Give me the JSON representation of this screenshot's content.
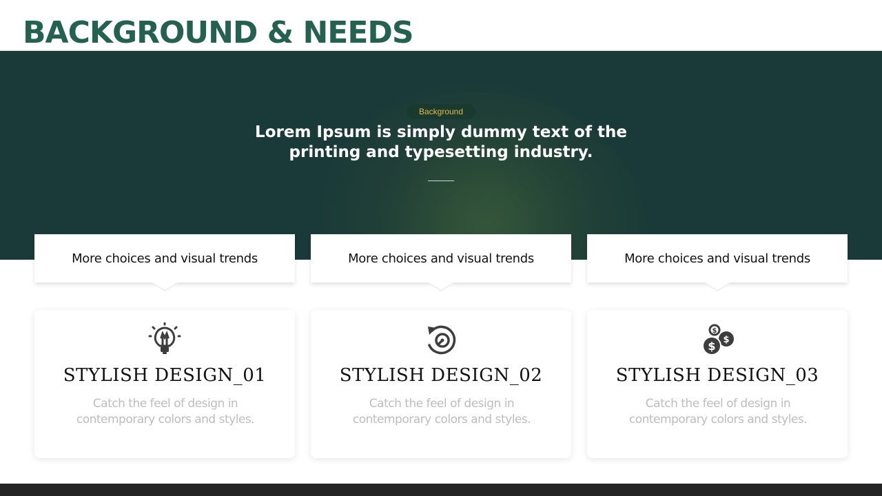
{
  "page": {
    "title": "BACKGROUND & NEEDS"
  },
  "hero": {
    "badge": "Background",
    "text": "Lorem Ipsum is simply dummy text of the printing and typesetting industry."
  },
  "labels": [
    "More choices and visual trends",
    "More choices and visual trends",
    "More choices and visual trends"
  ],
  "cards": [
    {
      "icon": "lightbulb-icon",
      "title": "STYLISH DESIGN_01",
      "desc": "Catch the feel of design in contemporary colors and styles."
    },
    {
      "icon": "clock-rotate-icon",
      "title": "STYLISH DESIGN_02",
      "desc": "Catch the feel of design in contemporary colors and styles."
    },
    {
      "icon": "coins-icon",
      "title": "STYLISH DESIGN_03",
      "desc": "Catch the feel of design in contemporary colors and styles."
    }
  ],
  "colors": {
    "brand_green": "#24624f",
    "hero_bg": "#1a3a39",
    "badge_text": "#e2b84a",
    "footer": "#242424"
  }
}
